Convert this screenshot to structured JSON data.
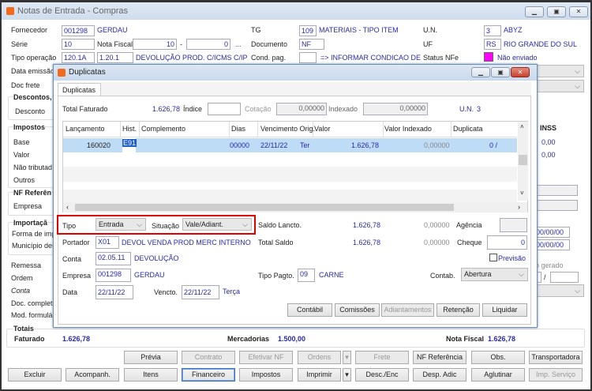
{
  "main": {
    "title": "Notas de Entrada - Compras",
    "fornecedor": {
      "label": "Fornecedor",
      "code": "001298",
      "name": "GERDAU"
    },
    "serie": {
      "label": "Série",
      "value": "10"
    },
    "nota_fiscal": {
      "label": "Nota Fiscal",
      "value": "10",
      "sep": "-",
      "suffix": "0",
      "lookup": "..."
    },
    "tipo_operacao": {
      "label": "Tipo operação",
      "code1": "120.1A",
      "code2": "1.20.1",
      "desc": "DEVOLUÇÃO  PROD. C/ICMS C/IPI S,"
    },
    "data_emissao_label": "Data emissão",
    "doc_frete_label": "Doc frete",
    "tg": {
      "label": "TG",
      "code": "109",
      "desc": "MATERIAIS - TIPO ITEM"
    },
    "documento": {
      "label": "Documento",
      "value": "NF"
    },
    "cond_pag": {
      "label": "Cond. pag.",
      "value": "",
      "desc": "=> INFORMAR CONDICAO DE PA"
    },
    "un": {
      "label": "U.N.",
      "code": "3",
      "desc": "ABYZ"
    },
    "uf": {
      "label": "UF",
      "code": "RS",
      "desc": "RIO GRANDE DO SUL"
    },
    "status_nfe": {
      "label": "Status NFe",
      "value": "Não enviado",
      "color": "#ff00ff"
    },
    "descontos": {
      "title": "Descontos,",
      "desconto_label": "Desconto"
    },
    "impostos": {
      "title": "Impostos",
      "rows": [
        "Base",
        "Valor",
        "Não tributad",
        "Outros"
      ],
      "inss_label": "INSS",
      "inss_values": [
        "0,00",
        "0,00"
      ]
    },
    "nf_ref": {
      "title": "NF Referên",
      "empresa_label": "Empresa"
    },
    "importacao": {
      "title": "Importaçã",
      "forma_label": "Forma de imp",
      "municipio_label": "Município des",
      "dates": [
        "00/00/00",
        "00/00/00"
      ]
    },
    "lower_labels": [
      "Remessa",
      "Ordem",
      "Conta",
      "Doc. completo",
      "Mod. formulár"
    ],
    "gerado_label": "o gerado",
    "gerado_sep": "/",
    "totais": {
      "title": "Totais",
      "faturado_label": "Faturado",
      "faturado": "1.626,78",
      "mercadorias_label": "Mercadorias",
      "mercadorias": "1.500,00",
      "nf_label": "Nota Fiscal",
      "nf": "1.626,78"
    },
    "buttons_row1": [
      "Prévia",
      "Contrato",
      "Efetivar NF",
      "Ordens",
      "Frete",
      "NF Referência",
      "Obs.",
      "Transportadora"
    ],
    "buttons_row2": [
      "Excluir",
      "Acompanh.",
      "Itens",
      "Financeiro",
      "Impostos",
      "Imprimir",
      "Desc./Enc",
      "Desp. Adic",
      "Aglutinar",
      "Imp. Serviço"
    ]
  },
  "dialog": {
    "title": "Duplicatas",
    "tab": "Duplicatas",
    "total_faturado": {
      "label": "Total Faturado",
      "value": "1.626,78"
    },
    "indice": {
      "label": "Índice",
      "value": ""
    },
    "cotacao": {
      "label": "Cotação",
      "value": "0,00000"
    },
    "indexado": {
      "label": "Indexado",
      "value": "0,00000"
    },
    "un": {
      "label": "U.N.",
      "value": "3"
    },
    "grid": {
      "columns": [
        "Lançamento",
        "Hist.",
        "Complemento",
        "Dias",
        "Vencimento Orig.",
        "Valor",
        "Valor Indexado",
        "Duplicata"
      ],
      "rows": [
        {
          "lancamento": "160020",
          "hist": "E91",
          "complemento": "",
          "dias": "00000",
          "vencimento": "22/11/22",
          "orig": "Ter",
          "valor": "1.626,78",
          "valor_indexado": "0,00000",
          "duplicata": "0 /"
        }
      ]
    },
    "tipo": {
      "label": "Tipo",
      "value": "Entrada"
    },
    "situacao": {
      "label": "Situação",
      "value": "Vale/Adiant."
    },
    "saldo_lancto": {
      "label": "Saldo Lancto.",
      "value": "1.626,78",
      "indexado": "0,00000"
    },
    "total_saldo": {
      "label": "Total Saldo",
      "value": "1.626,78",
      "indexado": "0,00000"
    },
    "agencia": {
      "label": "Agência",
      "value": ""
    },
    "cheque": {
      "label": "Cheque",
      "value": "0"
    },
    "previsao": {
      "label": "Previsão",
      "checked": false
    },
    "portador": {
      "label": "Portador",
      "code": "X01",
      "desc": "DEVOL VENDA PROD MERC INTERNO"
    },
    "conta": {
      "label": "Conta",
      "code": "02.05.11",
      "desc": "DEVOLUÇÃO"
    },
    "empresa": {
      "label": "Empresa",
      "code": "001298",
      "desc": "GERDAU"
    },
    "tipo_pagto": {
      "label": "Tipo Pagto.",
      "code": "09",
      "desc": "CARNE"
    },
    "contab": {
      "label": "Contab.",
      "value": "Abertura"
    },
    "data": {
      "label": "Data",
      "value": "22/11/22"
    },
    "vencto": {
      "label": "Vencto.",
      "value": "22/11/22",
      "weekday": "Terça"
    },
    "buttons": [
      "Contábil",
      "Comissões",
      "Adiantamentos",
      "Retenção",
      "Liquidar"
    ]
  }
}
